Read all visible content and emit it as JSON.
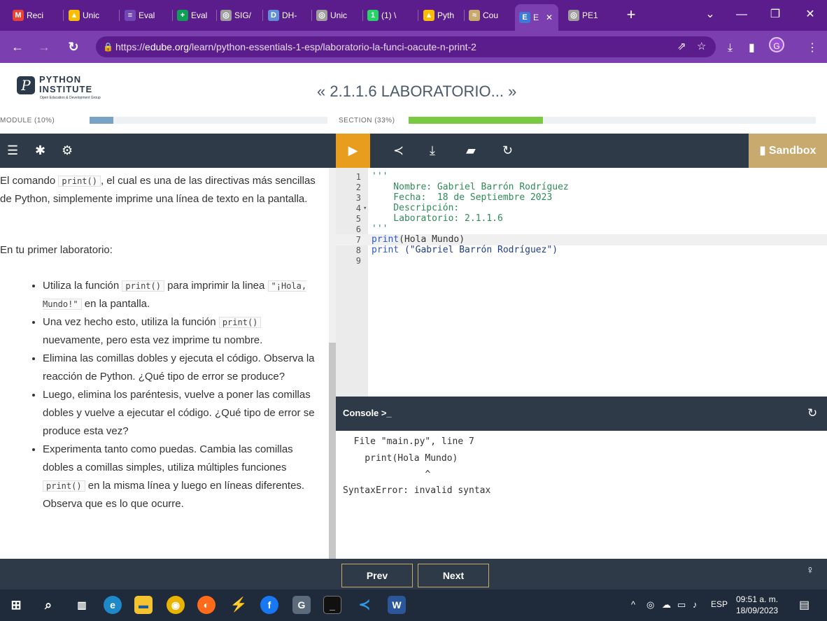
{
  "browser": {
    "tabs": [
      {
        "label": "Reci",
        "icon": "gmail-icon",
        "color": "#ea4335"
      },
      {
        "label": "Unic",
        "icon": "drive-icon",
        "color": "#fbbc04"
      },
      {
        "label": "Eval",
        "icon": "forms-icon",
        "color": "#7248b9"
      },
      {
        "label": "Eval",
        "icon": "plus-app-icon",
        "color": "#0f9d58"
      },
      {
        "label": "SIG/",
        "icon": "globe-icon",
        "color": "#9e9e9e"
      },
      {
        "label": "DH-",
        "icon": "doc-icon",
        "color": "#5e8fd8"
      },
      {
        "label": "Unic",
        "icon": "globe-icon",
        "color": "#9e9e9e"
      },
      {
        "label": "(1) \\",
        "icon": "whatsapp-icon",
        "color": "#25d366"
      },
      {
        "label": "Pyth",
        "icon": "drive-icon",
        "color": "#fbbc04"
      },
      {
        "label": "Cou",
        "icon": "course-icon",
        "color": "#c8a96e"
      },
      {
        "label": "E",
        "icon": "edube-icon",
        "color": "#3d7bd8",
        "active": true
      },
      {
        "label": "PE1",
        "icon": "globe-icon",
        "color": "#9e9e9e"
      }
    ],
    "close_tab_glyph": "✕",
    "new_tab": "+",
    "window_controls": {
      "chevron": "⌄",
      "minimize": "—",
      "restore": "❐",
      "close": "✕"
    },
    "url_prefix": "https://",
    "url_domain": "edube.org",
    "url_path": "/learn/python-essentials-1-esp/laboratorio-la-funci-oacute-n-print-2",
    "profile_initial": "G"
  },
  "header": {
    "logo_line1": "PYTHON",
    "logo_line2": "INSTITUTE",
    "logo_tagline": "Open Education & Development Group",
    "logo_mark": "P",
    "breadcrumb": "« 2.1.1.6 LABORATORIO... »",
    "module_label": "MODULE (10%)",
    "module_progress": 0.1,
    "section_label": "SECTION (33%)",
    "section_progress": 0.33,
    "progress_color": "#79a2c7",
    "section_color": "#7ac943"
  },
  "instructions": {
    "intro_before": "El comando",
    "intro_code": "print()",
    "intro_after": ", el cual es una de las directivas más sencillas de Python, simplemente imprime una línea de texto en la pantalla.",
    "lab_title": "En tu primer laboratorio:",
    "bullets": [
      {
        "before": "Utiliza la función",
        "code": "print()",
        "after": "para imprimir la linea",
        "code2": "\"¡Hola, Mundo!\"",
        "after2": "en la pantalla."
      },
      {
        "before": "Una vez hecho esto, utiliza la función",
        "code": "print()",
        "after": "nuevamente, pero esta vez imprime tu nombre."
      },
      {
        "text": "Elimina las comillas dobles y ejecuta el código. Observa la reacción de Python. ¿Qué tipo de error se produce?"
      },
      {
        "text": "Luego, elimina los paréntesis, vuelve a poner las comillas dobles y vuelve a ejecutar el código. ¿Qué tipo de error se produce esta vez?"
      },
      {
        "before": "Experimenta tanto como puedas. Cambia las comillas dobles a comillas simples, utiliza múltiples funciones",
        "code": "print()",
        "after": "en la misma línea y luego en líneas diferentes. Observa que es lo que ocurre."
      }
    ]
  },
  "editor": {
    "sandbox_label": "Sandbox",
    "lines": [
      {
        "n": "1",
        "text": "'''",
        "color": "#2e8b57"
      },
      {
        "n": "2",
        "text": "    Nombre: Gabriel Barrón Rodríguez",
        "color": "#2e8b57"
      },
      {
        "n": "3",
        "text": "    Fecha:  18 de Septiembre 2023",
        "color": "#2e8b57"
      },
      {
        "n": "4",
        "text": "    Descripción:",
        "color": "#2e8b57",
        "fold": "▾"
      },
      {
        "n": "5",
        "text": "    Laboratorio: 2.1.1.6",
        "color": "#2e8b57"
      },
      {
        "n": "6",
        "text": "'''",
        "color": "#2e8b57"
      },
      {
        "n": "7",
        "kw": "print",
        "rest": "(Hola Mundo)",
        "highlight": true
      },
      {
        "n": "8",
        "kw": "print",
        "rest": " (\"Gabriel Barrón Rodríguez\")"
      },
      {
        "n": "9",
        "text": ""
      }
    ]
  },
  "console": {
    "title": "Console >_",
    "lines": [
      "  File \"main.py\", line 7",
      "    print(Hola Mundo)",
      "               ^",
      "SyntaxError: invalid syntax"
    ]
  },
  "navigation": {
    "prev_label": "Prev",
    "next_label": "Next"
  },
  "taskbar": {
    "language": "ESP",
    "time": "09:51 a. m.",
    "date": "18/09/2023"
  }
}
